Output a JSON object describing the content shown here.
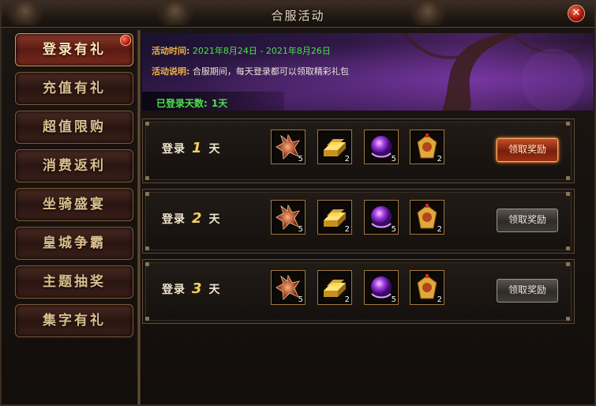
{
  "window": {
    "title": "合服活动"
  },
  "sidebar": {
    "items": [
      {
        "label": "登录有礼",
        "active": true,
        "badge": true
      },
      {
        "label": "充值有礼"
      },
      {
        "label": "超值限购"
      },
      {
        "label": "消费返利"
      },
      {
        "label": "坐骑盛宴"
      },
      {
        "label": "皇城争霸"
      },
      {
        "label": "主题抽奖"
      },
      {
        "label": "集字有礼"
      }
    ]
  },
  "banner": {
    "time_label": "活动时间:",
    "time_value": "2021年8月24日 - 2021年8月26日",
    "desc_label": "活动说明:",
    "desc_value": "合服期间，每天登录都可以领取精彩礼包",
    "days_label": "已登录天数:",
    "days_value": "1天"
  },
  "rewards": [
    {
      "day_prefix": "登录",
      "day_num": "1",
      "day_suffix": "天",
      "items": [
        {
          "icon": "red-crystal-icon",
          "count": "5"
        },
        {
          "icon": "gold-bar-icon",
          "count": "2"
        },
        {
          "icon": "purple-orb-icon",
          "count": "5"
        },
        {
          "icon": "gold-token-icon",
          "count": "2"
        }
      ],
      "button_label": "领取奖励",
      "claimable": true
    },
    {
      "day_prefix": "登录",
      "day_num": "2",
      "day_suffix": "天",
      "items": [
        {
          "icon": "red-crystal-icon",
          "count": "5"
        },
        {
          "icon": "gold-bar-icon",
          "count": "2"
        },
        {
          "icon": "purple-orb-icon",
          "count": "5"
        },
        {
          "icon": "gold-token-icon",
          "count": "2"
        }
      ],
      "button_label": "领取奖励",
      "claimable": false
    },
    {
      "day_prefix": "登录",
      "day_num": "3",
      "day_suffix": "天",
      "items": [
        {
          "icon": "red-crystal-icon",
          "count": "5"
        },
        {
          "icon": "gold-bar-icon",
          "count": "2"
        },
        {
          "icon": "purple-orb-icon",
          "count": "5"
        },
        {
          "icon": "gold-token-icon",
          "count": "2"
        }
      ],
      "button_label": "领取奖励",
      "claimable": false
    }
  ]
}
